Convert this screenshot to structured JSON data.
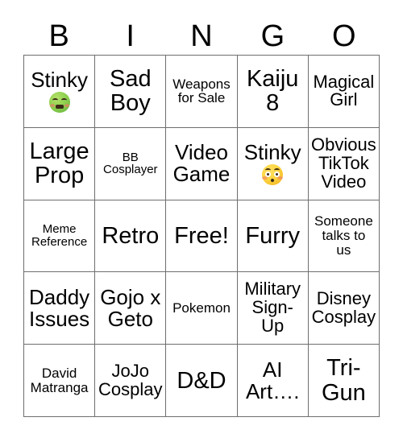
{
  "card": {
    "title": "BINGO",
    "header_letters": [
      "B",
      "I",
      "N",
      "G",
      "O"
    ],
    "columns": 5,
    "rows": 5,
    "border_color": "#6e6e6e",
    "background_color": "#ffffff",
    "text_color": "#000000",
    "free_space": "Free!",
    "cells": [
      [
        {
          "text": "Stinky",
          "size": "fs-lg",
          "emoji": "nauseated-face-emoji"
        },
        {
          "text": "Sad\nBoy",
          "size": "fs-xl",
          "emoji": null
        },
        {
          "text": "Weapons\nfor Sale",
          "size": "fs-sm",
          "emoji": null
        },
        {
          "text": "Kaiju\n8",
          "size": "fs-xl",
          "emoji": null
        },
        {
          "text": "Magical\nGirl",
          "size": "fs-md",
          "emoji": null
        }
      ],
      [
        {
          "text": "Large\nProp",
          "size": "fs-xl",
          "emoji": null
        },
        {
          "text": "BB\nCosplayer",
          "size": "fs-xs",
          "emoji": null
        },
        {
          "text": "Video\nGame",
          "size": "fs-lg",
          "emoji": null
        },
        {
          "text": "Stinky",
          "size": "fs-lg",
          "emoji": "flushed-face-emoji"
        },
        {
          "text": "Obvious\nTikTok\nVideo",
          "size": "fs-md",
          "emoji": null
        }
      ],
      [
        {
          "text": "Meme\nReference",
          "size": "fs-xs",
          "emoji": null
        },
        {
          "text": "Retro",
          "size": "fs-xl",
          "emoji": null
        },
        {
          "text": "Free!",
          "size": "fs-xl",
          "emoji": null
        },
        {
          "text": "Furry",
          "size": "fs-xl",
          "emoji": null
        },
        {
          "text": "Someone\ntalks to\nus",
          "size": "fs-sm",
          "emoji": null
        }
      ],
      [
        {
          "text": "Daddy\nIssues",
          "size": "fs-lg",
          "emoji": null
        },
        {
          "text": "Gojo x\nGeto",
          "size": "fs-lg",
          "emoji": null
        },
        {
          "text": "Pokemon",
          "size": "fs-sm",
          "emoji": null
        },
        {
          "text": "Military\nSign-\nUp",
          "size": "fs-md",
          "emoji": null
        },
        {
          "text": "Disney\nCosplay",
          "size": "fs-md",
          "emoji": null
        }
      ],
      [
        {
          "text": "David\nMatranga",
          "size": "fs-sm",
          "emoji": null
        },
        {
          "text": "JoJo\nCosplay",
          "size": "fs-md",
          "emoji": null
        },
        {
          "text": "D&D",
          "size": "fs-xl",
          "emoji": null
        },
        {
          "text": "AI\nArt….",
          "size": "fs-lg",
          "emoji": null
        },
        {
          "text": "Tri-\nGun",
          "size": "fs-xl",
          "emoji": null
        }
      ]
    ]
  }
}
